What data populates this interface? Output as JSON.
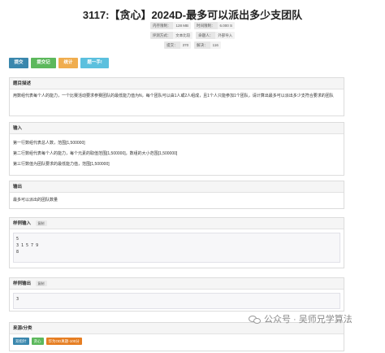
{
  "problem": {
    "title": "3117:【贪心】2024D-最多可以派出多少支团队"
  },
  "meta": {
    "time_limit_label": "内存限制：",
    "time_limit_value": "128 MB",
    "mem_limit_label": "时间限制：",
    "mem_limit_value": "6.000 S",
    "judge_label": "评测方式：",
    "judge_value": "文本比较",
    "author_label": "命题人：",
    "author_value": "外部导入",
    "submit_label": "提交：",
    "submit_value": "370",
    "solved_label": "解决：",
    "solved_value": "116"
  },
  "actions": {
    "submit": "提交",
    "record": "提交记录",
    "stats": "统计",
    "hint": "题一手!"
  },
  "sections": {
    "desc_title": "题目描述",
    "desc_text": "用数组代表每个人的能力，一个比赛活动要求参赛团队的最低能力值为N，每个团队可以由1人或2人组成，且1个人只能参加1个团队，请计算出最多可以派出多少支符合要求的团队",
    "input_title": "输入",
    "input_line1": "第一行数组代表总人数，范围[1,500000]",
    "input_line2": "第二行数组代表每个人的能力，每个元素的取值范围[1,500000]，数组的大小范围[1,500000]",
    "input_line3": "第三行数值为团队要求的最低能力值，范围[1,500000]",
    "output_title": "输出",
    "output_text": "最多可以派出的团队数量",
    "sample_in_title": "样例输入",
    "sample_in_copy": "复制",
    "sample_in_code": "5\n3 1 5 7 9\n8",
    "sample_out_title": "样例输出",
    "sample_out_copy": "复制",
    "sample_out_code": "3",
    "source_title": "来源/分类"
  },
  "tags": {
    "t1": "双指针",
    "t2": "贪心",
    "t3": "华为OD真题-100分"
  },
  "watermark": {
    "text": "公众号 · 吴师兄学算法"
  },
  "colors": {
    "primary": "#3a87ad",
    "success": "#5cb85c",
    "warning": "#f0ad4e",
    "info": "#5bc0de",
    "orange": "#e67e22"
  }
}
